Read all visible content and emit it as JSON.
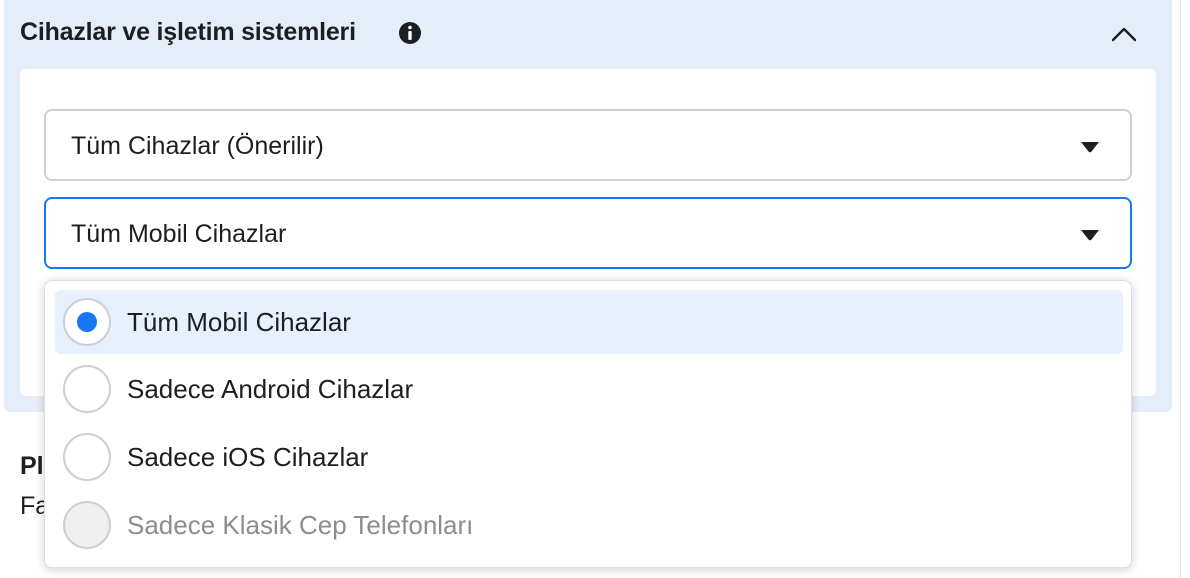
{
  "section": {
    "title": "Cihazlar ve işletim sistemleri",
    "info_icon": "info-icon",
    "collapse_icon": "chevron-up-icon"
  },
  "selects": {
    "devices": {
      "value": "Tüm Cihazlar (Önerilir)",
      "icon": "caret-down-icon"
    },
    "mobile": {
      "value": "Tüm Mobil Cihazlar",
      "icon": "caret-down-icon"
    }
  },
  "below": {
    "title_partial": "Pl",
    "text_partial": "Fa"
  },
  "dropdown": {
    "options": [
      {
        "label": "Tüm Mobil Cihazlar",
        "selected": true,
        "disabled": false
      },
      {
        "label": "Sadece Android Cihazlar",
        "selected": false,
        "disabled": false
      },
      {
        "label": "Sadece iOS Cihazlar",
        "selected": false,
        "disabled": false
      },
      {
        "label": "Sadece Klasik Cep Telefonları",
        "selected": false,
        "disabled": true
      }
    ]
  },
  "colors": {
    "accent": "#1877f2",
    "panel_bg": "#e4eef8",
    "selected_bg": "#e7f0fd",
    "disabled_text": "#8a8d91"
  }
}
